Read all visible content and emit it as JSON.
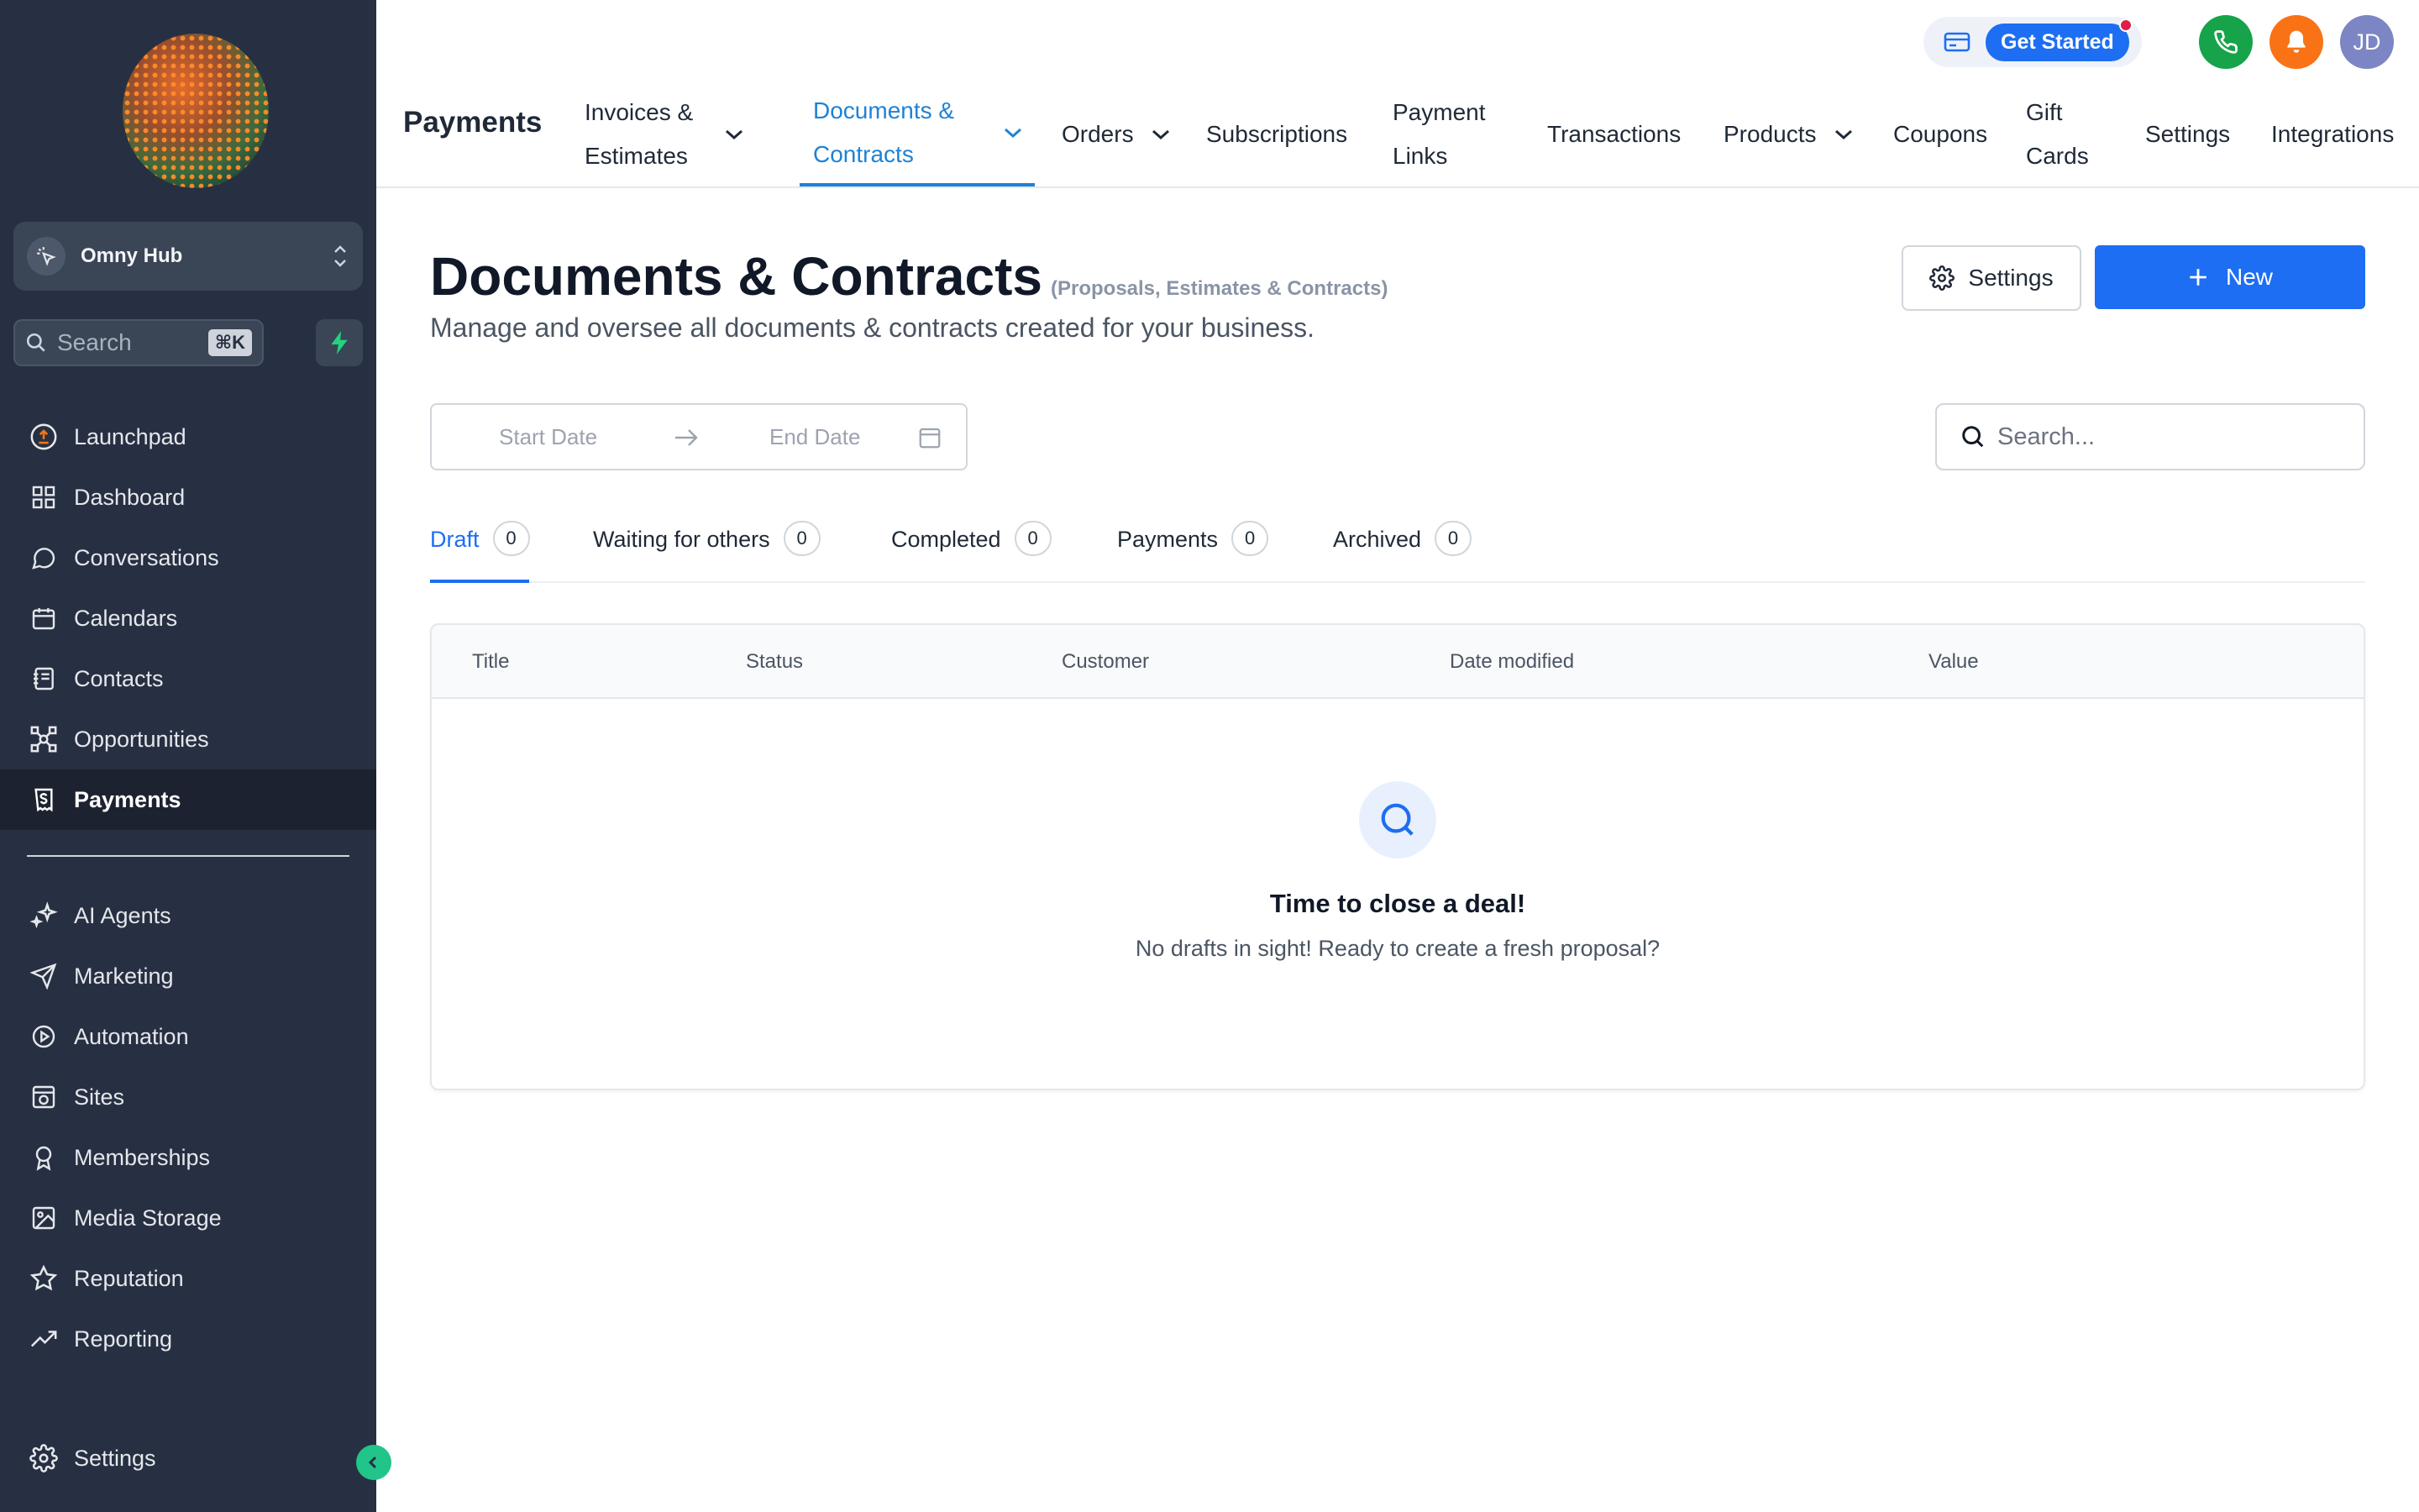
{
  "sidebar": {
    "account": {
      "name": "Omny Hub"
    },
    "search": {
      "placeholder": "Search",
      "shortcut": "⌘K"
    },
    "items": [
      {
        "label": "Launchpad",
        "icon": "launchpad-icon"
      },
      {
        "label": "Dashboard",
        "icon": "dashboard-icon"
      },
      {
        "label": "Conversations",
        "icon": "chat-icon"
      },
      {
        "label": "Calendars",
        "icon": "calendar-icon"
      },
      {
        "label": "Contacts",
        "icon": "contacts-icon"
      },
      {
        "label": "Opportunities",
        "icon": "opportunities-icon"
      },
      {
        "label": "Payments",
        "icon": "payments-icon",
        "active": true
      }
    ],
    "items2": [
      {
        "label": "AI Agents",
        "icon": "sparkle-icon"
      },
      {
        "label": "Marketing",
        "icon": "send-icon"
      },
      {
        "label": "Automation",
        "icon": "automation-icon"
      },
      {
        "label": "Sites",
        "icon": "sites-icon"
      },
      {
        "label": "Memberships",
        "icon": "badge-icon"
      },
      {
        "label": "Media Storage",
        "icon": "image-icon"
      },
      {
        "label": "Reputation",
        "icon": "star-icon"
      },
      {
        "label": "Reporting",
        "icon": "trend-icon"
      }
    ],
    "settings": {
      "label": "Settings"
    }
  },
  "header": {
    "get_started": "Get Started",
    "avatar_initials": "JD",
    "module_title": "Payments",
    "tabs": [
      {
        "label": "Invoices & Estimates"
      },
      {
        "label": "Documents & Contracts",
        "active": true
      },
      {
        "label": "Orders"
      },
      {
        "label": "Subscriptions"
      },
      {
        "label": "Payment Links"
      },
      {
        "label": "Transactions"
      },
      {
        "label": "Products"
      },
      {
        "label": "Coupons"
      },
      {
        "label": "Gift Cards"
      },
      {
        "label": "Settings"
      },
      {
        "label": "Integrations"
      }
    ]
  },
  "main": {
    "title": "Documents & Contracts",
    "subtitle": "(Proposals, Estimates & Contracts)",
    "description": "Manage and oversee all documents & contracts created for your business.",
    "settings_button": "Settings",
    "new_button": "New",
    "date_range": {
      "start_placeholder": "Start Date",
      "end_placeholder": "End Date"
    },
    "search_placeholder": "Search...",
    "status_tabs": [
      {
        "label": "Draft",
        "count": "0",
        "active": true
      },
      {
        "label": "Waiting for others",
        "count": "0"
      },
      {
        "label": "Completed",
        "count": "0"
      },
      {
        "label": "Payments",
        "count": "0"
      },
      {
        "label": "Archived",
        "count": "0"
      }
    ],
    "table": {
      "columns": [
        "Title",
        "Status",
        "Customer",
        "Date modified",
        "Value"
      ],
      "empty_title": "Time to close a deal!",
      "empty_text": "No drafts in sight! Ready to create a fresh proposal?"
    }
  },
  "colors": {
    "sidebar_bg": "#273042",
    "accent_blue": "#1d6ef2",
    "tab_active": "#1e82d6",
    "phone_green": "#16a34a",
    "bell_orange": "#f97316",
    "collapse_green": "#21c58a"
  }
}
